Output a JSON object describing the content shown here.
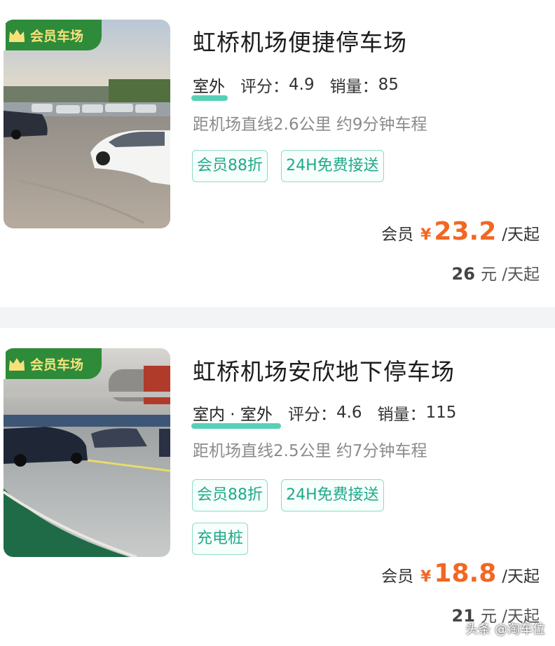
{
  "listings": [
    {
      "badge": "会员车场",
      "title": "虹桥机场便捷停车场",
      "location_type": "室外",
      "rating_label": "评分：",
      "rating": "4.9",
      "sales_label": "销量：",
      "sales": "85",
      "distance": "距机场直线2.6公里 约9分钟车程",
      "tags": [
        "会员88折",
        "24H免费接送"
      ],
      "member_label": "会员",
      "currency": "¥",
      "member_price": "23.2",
      "member_unit": "/天起",
      "standard_price": "26",
      "standard_unit": "元 /天起",
      "image_icon": "outdoor-parking-lot-photo"
    },
    {
      "badge": "会员车场",
      "title": "虹桥机场安欣地下停车场",
      "location_type": "室内 · 室外",
      "rating_label": "评分：",
      "rating": "4.6",
      "sales_label": "销量：",
      "sales": "115",
      "distance": "距机场直线2.5公里 约7分钟车程",
      "tags": [
        "会员88折",
        "24H免费接送",
        "充电桩"
      ],
      "member_label": "会员",
      "currency": "¥",
      "member_price": "18.8",
      "member_unit": "/天起",
      "standard_price": "21",
      "standard_unit": "元 /天起",
      "image_icon": "underground-parking-photo"
    }
  ],
  "watermark": "头条 @淘车位",
  "colors": {
    "accent_orange": "#f26722",
    "tag_green": "#20a98a",
    "badge_green": "#2e8b3a",
    "badge_text": "#f7e27a",
    "underline_teal": "#39c9a8"
  }
}
